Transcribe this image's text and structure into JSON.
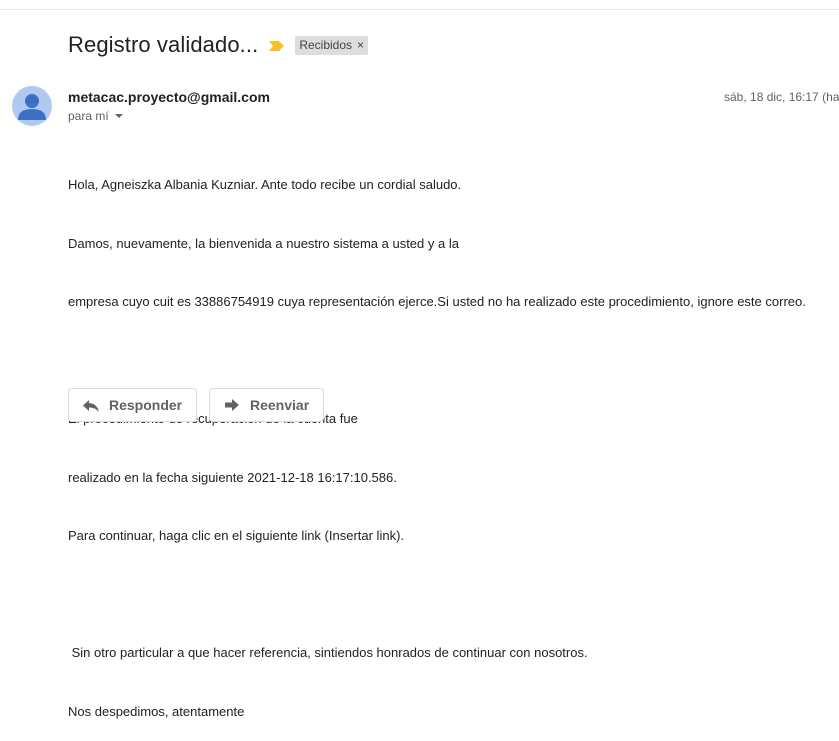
{
  "email": {
    "subject": "Registro validado...",
    "label": "Recibidos",
    "label_close": "×",
    "sender": "metacac.proyecto@gmail.com",
    "to": "para mí",
    "date": "sáb, 18 dic, 16:17 (ha",
    "body_lines": [
      "Hola, Agneiszka Albania Kuzniar. Ante todo recibe un cordial saludo.",
      "Damos, nuevamente, la bienvenida a nuestro sistema a usted y a la",
      "empresa cuyo cuit es 33886754919 cuya representación ejerce.Si usted no ha realizado este procedimiento, ignore este correo.",
      "",
      "El procedimiento de recuperación de la cuenta fue",
      "realizado en la fecha siguiente 2021-12-18 16:17:10.586.",
      "Para continuar, haga clic en el siguiente link (Insertar link).",
      "",
      " Sin otro particular a que hacer referencia, sintiendos honrados de continuar con nosotros.",
      "Nos despedimos, atentamente"
    ]
  },
  "actions": {
    "reply_label": "Responder",
    "forward_label": "Reenviar"
  },
  "colors": {
    "importance": "#f6c026",
    "avatar_bg": "#b0c9f0",
    "avatar_fg": "#3f6ec6"
  }
}
